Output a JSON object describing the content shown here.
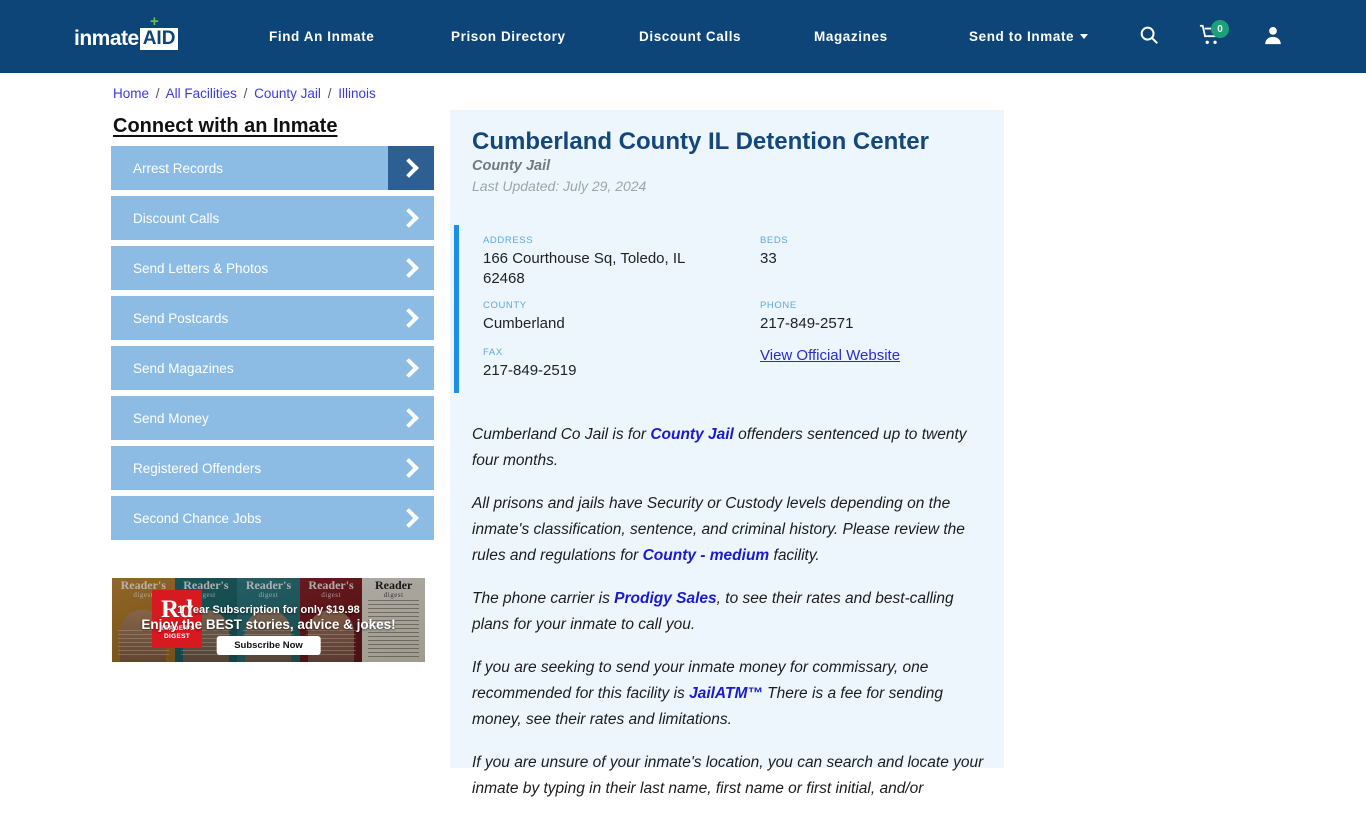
{
  "header": {
    "logo": {
      "word": "inmate",
      "badge": "AID",
      "plus": "+"
    },
    "nav": [
      {
        "label": "Find An Inmate"
      },
      {
        "label": "Prison Directory"
      },
      {
        "label": "Discount Calls"
      },
      {
        "label": "Magazines"
      },
      {
        "label": "Send to Inmate"
      }
    ],
    "icons": {
      "search": "search-icon",
      "cart": "cart-icon",
      "user": "user-icon"
    },
    "cart_count": "0",
    "colors": {
      "bar": "#0d4578",
      "badge": "#1aa179",
      "plus": "#72bf44"
    }
  },
  "breadcrumb": {
    "items": [
      "Home",
      "All Facilities",
      "County Jail",
      "Illinois"
    ],
    "separator": "/"
  },
  "sidebar": {
    "title": "Connect with an Inmate",
    "items": [
      {
        "label": "Arrest Records",
        "active": true
      },
      {
        "label": "Discount Calls",
        "active": false
      },
      {
        "label": "Send Letters & Photos",
        "active": false
      },
      {
        "label": "Send Postcards",
        "active": false
      },
      {
        "label": "Send Magazines",
        "active": false
      },
      {
        "label": "Send Money",
        "active": false
      },
      {
        "label": "Registered Offenders",
        "active": false
      },
      {
        "label": "Second Chance Jobs",
        "active": false
      }
    ]
  },
  "ad": {
    "brand": "Rd",
    "brand_sub": "READER'S DIGEST",
    "line1": "1 Year Subscription for only $19.98",
    "line2": "Enjoy the BEST stories, advice & jokes!",
    "cta": "Subscribe Now",
    "covers": [
      {
        "title": "Reader's",
        "sub": "digest"
      },
      {
        "title": "Reader's",
        "sub": "digest"
      },
      {
        "title": "Reader's",
        "sub": "digest"
      },
      {
        "title": "Reader's",
        "sub": "digest"
      },
      {
        "title": "Reader",
        "sub": "digest"
      }
    ]
  },
  "facility": {
    "name": "Cumberland County IL Detention Center",
    "type": "County Jail",
    "last_updated": "Last Updated: July 29, 2024",
    "fields": {
      "address_label": "ADDRESS",
      "address_value": "166 Courthouse Sq, Toledo, IL 62468",
      "county_label": "COUNTY",
      "county_value": "Cumberland",
      "fax_label": "FAX",
      "fax_value": "217-849-2519",
      "beds_label": "BEDS",
      "beds_value": "33",
      "phone_label": "PHONE",
      "phone_value": "217-849-2571",
      "website_link": "View Official Website"
    },
    "paragraphs": {
      "p1a": "Cumberland Co Jail is for ",
      "p1b": "County Jail",
      "p1c": " offenders sentenced up to twenty four months.",
      "p2a": "All prisons and jails have Security or Custody levels depending on the inmate's classification, sentence, and criminal history. Please review the rules and regulations for ",
      "p2b": "County - medium",
      "p2c": " facility.",
      "p3a": "The phone carrier is ",
      "p3b": "Prodigy Sales",
      "p3c": ", to see their rates and best-calling plans for your inmate to call you.",
      "p4a": "If you are seeking to send your inmate money for commissary, one recommended for this facility is ",
      "p4b": "JailATM™",
      "p4c": " There is a fee for sending money, see their rates and limitations.",
      "p5a": "If you are unsure of your inmate's location, you can search and locate your inmate by typing in their last name, first name or first initial, and/or"
    }
  }
}
